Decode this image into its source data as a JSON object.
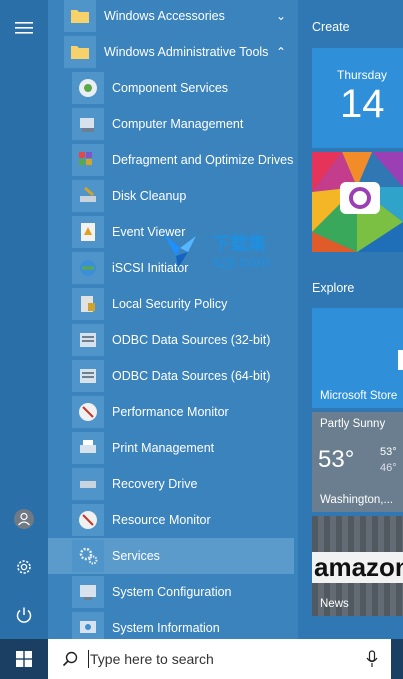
{
  "rail": {
    "menu_icon": "hamburger-icon",
    "user_icon": "user-icon",
    "settings_icon": "gear-icon",
    "power_icon": "power-icon"
  },
  "apps": {
    "folders": [
      {
        "label": "Windows Accessories",
        "chevron": "⌄"
      },
      {
        "label": "Windows Administrative Tools",
        "chevron": "⌃"
      }
    ],
    "items": [
      {
        "label": "Component Services"
      },
      {
        "label": "Computer Management"
      },
      {
        "label": "Defragment and Optimize Drives"
      },
      {
        "label": "Disk Cleanup"
      },
      {
        "label": "Event Viewer"
      },
      {
        "label": "iSCSI Initiator"
      },
      {
        "label": "Local Security Policy"
      },
      {
        "label": "ODBC Data Sources (32-bit)"
      },
      {
        "label": "ODBC Data Sources (64-bit)"
      },
      {
        "label": "Performance Monitor"
      },
      {
        "label": "Print Management"
      },
      {
        "label": "Recovery Drive"
      },
      {
        "label": "Resource Monitor"
      },
      {
        "label": "Services"
      },
      {
        "label": "System Configuration"
      },
      {
        "label": "System Information"
      }
    ]
  },
  "tiles": {
    "create_label": "Create",
    "explore_label": "Explore",
    "calendar": {
      "day": "Thursday",
      "date": "14"
    },
    "store_label": "Microsoft Store",
    "weather": {
      "condition": "Partly Sunny",
      "temp": "53°",
      "high": "53°",
      "low": "46°",
      "city": "Washington,..."
    },
    "news": {
      "label": "News",
      "brand": "amazon"
    }
  },
  "watermark": {
    "cn": "下载集",
    "url": "xzji.com"
  },
  "taskbar": {
    "search_placeholder": "Type here to search",
    "start_icon": "windows-logo-icon",
    "search_icon": "search-icon",
    "mic_icon": "microphone-icon"
  }
}
